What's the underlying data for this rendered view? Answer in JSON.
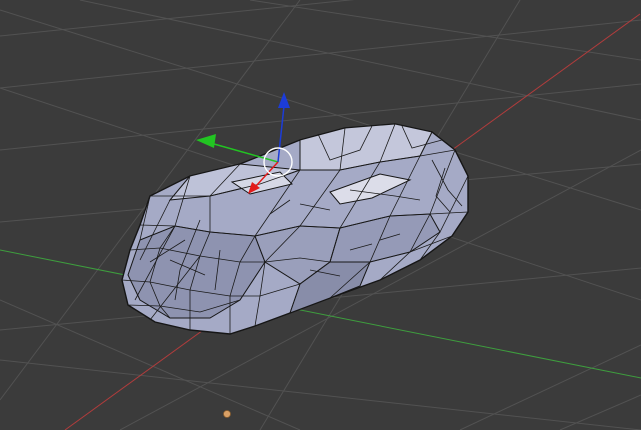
{
  "viewport": {
    "background": "#3b3b3b",
    "grid_color": "#525252",
    "x_axis_color": "#b03c3c",
    "y_axis_color": "#3e9e3e",
    "mesh_face_color": "#a3a8c4",
    "mesh_edge_color": "#121212",
    "gizmo": {
      "x_color": "#e21b1b",
      "y_color": "#22c422",
      "z_color": "#1c3cd8",
      "pivot_color": "#ffffff"
    },
    "light_color": "#d9a066"
  }
}
